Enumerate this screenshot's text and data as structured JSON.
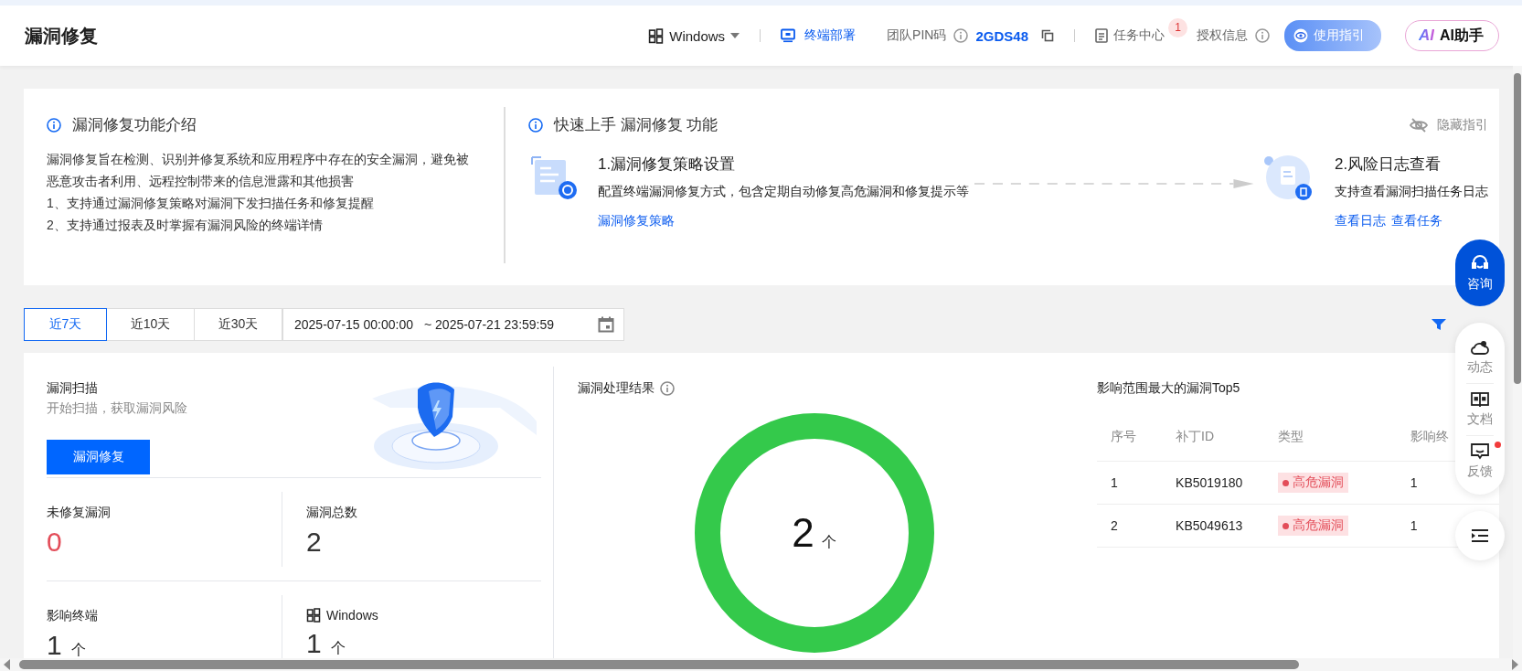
{
  "header": {
    "title": "漏洞修复",
    "os_select": "Windows",
    "deploy_link": "终端部署",
    "pin_label": "团队PIN码",
    "pin_value": "2GDS48",
    "task_center": "任务中心",
    "task_badge": "1",
    "license": "授权信息",
    "guide_button": "使用指引",
    "ai_logo": "AI",
    "ai_button": "AI助手"
  },
  "guide": {
    "intro_title": "漏洞修复功能介绍",
    "intro_text": "漏洞修复旨在检测、识别并修复系统和应用程序中存在的安全漏洞，避免被恶意攻击者利用、远程控制带来的信息泄露和其他损害",
    "intro_points": [
      "1、支持通过漏洞修复策略对漏洞下发扫描任务和修复提醒",
      "2、支持通过报表及时掌握有漏洞风险的终端详情"
    ],
    "quick_title": "快速上手 漏洞修复 功能",
    "hide_guide": "隐藏指引",
    "steps": [
      {
        "title": "1.漏洞修复策略设置",
        "desc": "配置终端漏洞修复方式，包含定期自动修复高危漏洞和修复提示等",
        "links": [
          "漏洞修复策略"
        ]
      },
      {
        "title": "2.风险日志查看",
        "desc": "支持查看漏洞扫描任务日志",
        "links": [
          "查看日志",
          "查看任务"
        ]
      }
    ]
  },
  "date_filter": {
    "ranges": [
      {
        "label": "近7天",
        "selected": true
      },
      {
        "label": "近10天",
        "selected": false
      },
      {
        "label": "近30天",
        "selected": false
      }
    ],
    "start": "2025-07-15 00:00:00",
    "end": "~ 2025-07-21 23:59:59"
  },
  "scan": {
    "title": "漏洞扫描",
    "subtitle": "开始扫描，获取漏洞风险",
    "button": "漏洞修复",
    "stats": [
      {
        "kind": "count",
        "label": "未修复漏洞",
        "value": "0",
        "alert": true
      },
      {
        "kind": "count",
        "label": "漏洞总数",
        "value": "2",
        "alert": false
      },
      {
        "kind": "count",
        "label": "影响终端",
        "value": "1",
        "unit": "个",
        "alert": false
      },
      {
        "kind": "os",
        "label": "Windows",
        "value": "1",
        "unit": "个",
        "alert": false
      }
    ]
  },
  "results": {
    "title": "漏洞处理结果",
    "total": "2",
    "unit": "个"
  },
  "top5": {
    "title": "影响范围最大的漏洞Top5",
    "columns": [
      "序号",
      "补丁ID",
      "类型",
      "影响终"
    ],
    "rows": [
      {
        "index": "1",
        "patch_id": "KB5019180",
        "type": "高危漏洞",
        "count": "1"
      },
      {
        "index": "2",
        "patch_id": "KB5049613",
        "type": "高危漏洞",
        "count": "1"
      }
    ]
  },
  "float_bar": {
    "consult": "咨询",
    "items": [
      {
        "kind": "cloud",
        "label": "动态",
        "unread": false
      },
      {
        "kind": "book",
        "label": "文档",
        "unread": false
      },
      {
        "kind": "feedback",
        "label": "反馈",
        "unread": true
      }
    ]
  }
}
